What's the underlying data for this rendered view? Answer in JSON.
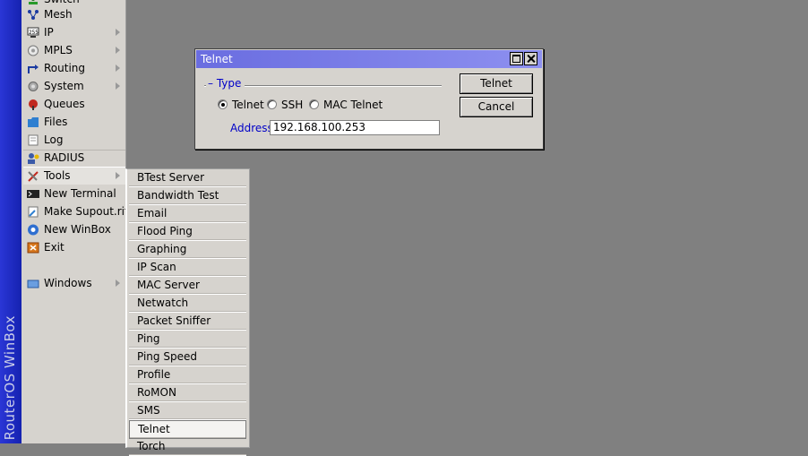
{
  "app": {
    "brand": "RouterOS WinBox"
  },
  "main_menu": {
    "items": [
      {
        "label": "Switch",
        "icon": "switch-icon",
        "has_submenu": false
      },
      {
        "label": "Mesh",
        "icon": "mesh-icon",
        "has_submenu": false
      },
      {
        "label": "IP",
        "icon": "ip-icon",
        "has_submenu": true
      },
      {
        "label": "MPLS",
        "icon": "mpls-icon",
        "has_submenu": true
      },
      {
        "label": "Routing",
        "icon": "routing-icon",
        "has_submenu": true
      },
      {
        "label": "System",
        "icon": "system-icon",
        "has_submenu": true
      },
      {
        "label": "Queues",
        "icon": "queues-icon",
        "has_submenu": false
      },
      {
        "label": "Files",
        "icon": "files-icon",
        "has_submenu": false
      },
      {
        "label": "Log",
        "icon": "log-icon",
        "has_submenu": false
      },
      {
        "label": "RADIUS",
        "icon": "radius-icon",
        "has_submenu": false
      },
      {
        "label": "Tools",
        "icon": "tools-icon",
        "has_submenu": true,
        "active": true
      },
      {
        "label": "New Terminal",
        "icon": "terminal-icon",
        "has_submenu": false
      },
      {
        "label": "Make Supout.rif",
        "icon": "supout-icon",
        "has_submenu": false
      },
      {
        "label": "New WinBox",
        "icon": "winbox-icon",
        "has_submenu": false
      },
      {
        "label": "Exit",
        "icon": "exit-icon",
        "has_submenu": false
      },
      {
        "label": "Windows",
        "icon": "windows-icon",
        "has_submenu": true
      }
    ]
  },
  "tools_submenu": {
    "items": [
      "BTest Server",
      "Bandwidth Test",
      "Email",
      "Flood Ping",
      "Graphing",
      "IP Scan",
      "MAC Server",
      "Netwatch",
      "Packet Sniffer",
      "Ping",
      "Ping Speed",
      "Profile",
      "RoMON",
      "SMS",
      "Telnet",
      "Torch"
    ],
    "selected": "Telnet"
  },
  "telnet_dialog": {
    "title": "Telnet",
    "type_group_label": "Type",
    "type_options": [
      "Telnet",
      "SSH",
      "MAC Telnet"
    ],
    "type_selected": "Telnet",
    "address_label": "Address:",
    "address_value": "192.168.100.253",
    "ok_button": "Telnet",
    "cancel_button": "Cancel"
  },
  "colors": {
    "desktop": "#808080",
    "menu_bg": "#d6d3ce",
    "strip": "#1a24c8",
    "titlebar": "#6b6ee0",
    "label_blue": "#0000c8"
  }
}
